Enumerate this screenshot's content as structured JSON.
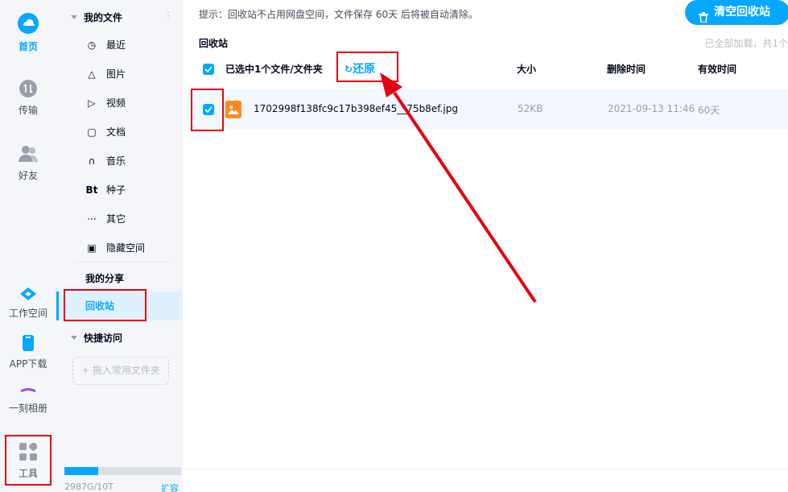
{
  "rail": {
    "home_label": "首页",
    "transfer_label": "传输",
    "friends_label": "好友",
    "workspace_label": "工作空间",
    "app_label": "APP下载",
    "album_label": "一刻相册",
    "tools_label": "工具"
  },
  "nav": {
    "my_files": "我的文件",
    "items": [
      {
        "label": "最近",
        "icon": "clock-icon"
      },
      {
        "label": "图片",
        "icon": "image-icon"
      },
      {
        "label": "视频",
        "icon": "play-icon"
      },
      {
        "label": "文档",
        "icon": "document-icon"
      },
      {
        "label": "音乐",
        "icon": "headphones-icon"
      },
      {
        "label": "种子",
        "icon": "bt-icon"
      },
      {
        "label": "其它",
        "icon": "more-icon"
      },
      {
        "label": "隐藏空间",
        "icon": "lock-icon"
      }
    ],
    "icon_glyphs": [
      "◷",
      "△",
      "▷",
      "▢",
      "∩",
      "Bt",
      "···",
      "▣"
    ],
    "my_share": "我的分享",
    "recycle_bin": "回收站",
    "quick_access": "快捷访问",
    "dropzone": "+ 拖入常用文件夹",
    "quota_text": "2987G/10T",
    "quota_link": "扩容",
    "quota_fraction": 0.29
  },
  "main": {
    "tip": "提示：回收站不占用网盘空间，文件保存 60天 后将被自动清除。",
    "clear_button": "清空回收站",
    "section_title": "回收站",
    "loaded_text": "已全部加载，共1个",
    "header": {
      "selected": "已选中1个文件/文件夹",
      "restore": "还原",
      "size": "大小",
      "deleted_time": "删除时间",
      "valid": "有效时间"
    },
    "rows": [
      {
        "name": "1702998f138fc9c17b398ef45__75b8ef.jpg",
        "size": "52KB",
        "deleted": "2021-09-13 11:46",
        "valid": "60天"
      }
    ]
  },
  "colors": {
    "accent": "#06a7ff",
    "annotation": "#e50012",
    "file_icon": "#ff8a1a"
  }
}
